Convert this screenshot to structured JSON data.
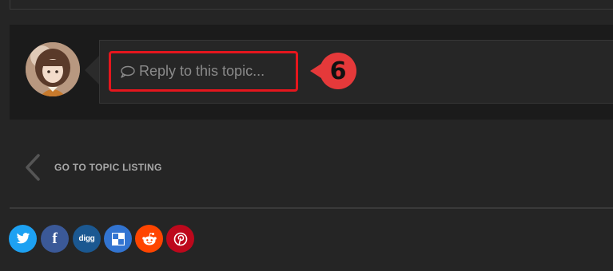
{
  "reply": {
    "placeholder": "Reply to this topic...",
    "annotation_number": "6"
  },
  "navigation": {
    "back_label": "GO TO TOPIC LISTING"
  },
  "share": {
    "buttons": [
      {
        "name": "twitter",
        "icon": "twitter-icon",
        "color": "#1da1f2",
        "label": ""
      },
      {
        "name": "facebook",
        "icon": "facebook-icon",
        "color": "#3b5998",
        "label": "f"
      },
      {
        "name": "digg",
        "icon": "digg-icon",
        "color": "#1b5891",
        "label": "digg"
      },
      {
        "name": "delicious",
        "icon": "delicious-icon",
        "color": "#3274d1",
        "label": ""
      },
      {
        "name": "reddit",
        "icon": "reddit-icon",
        "color": "#ff4500",
        "label": ""
      },
      {
        "name": "pinterest",
        "icon": "pinterest-icon",
        "color": "#bd081c",
        "label": ""
      }
    ]
  },
  "colors": {
    "page_background": "#252525",
    "reply_area_background": "#1b1b1b",
    "highlight_border": "#e5161d",
    "badge": "#e5393a",
    "muted_text": "#8a8a8a"
  }
}
